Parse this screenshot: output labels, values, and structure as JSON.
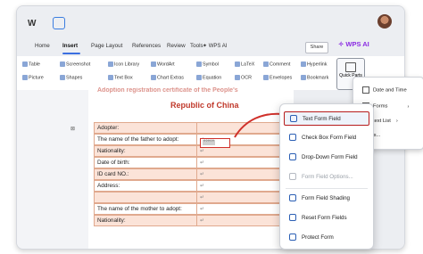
{
  "titlebar": {
    "logo": "W",
    "right_label": "WPS AI"
  },
  "menubar": {
    "items": [
      "Home",
      "Insert",
      "Page Layout",
      "References",
      "Review",
      "Tools"
    ],
    "active": "Insert",
    "ai_label": "WPS AI",
    "share_label": "Share"
  },
  "ribbon": {
    "table": "Table",
    "picture": "Picture",
    "screenshot": "Screenshot",
    "shapes": "Shapes",
    "icon_library": "Icon Library",
    "text_box": "Text Box",
    "wordart": "WordArt",
    "chart_extras": "Chart Extras",
    "symbol": "Symbol",
    "equation": "Equation",
    "latex": "LaTeX",
    "ocr": "OCR",
    "comment": "Comment",
    "envelopes": "Envelopes",
    "hyperlink": "Hyperlink",
    "bookmark": "Bookmark",
    "quick_parts": "Quick Parts"
  },
  "document": {
    "heading_faded": "Adoption registration certificate of the People's",
    "heading": "Republic of China",
    "rows": [
      {
        "label": "Adopter:",
        "mark": "↵"
      },
      {
        "label": "The name of the father to adopt:",
        "mark": "↵"
      },
      {
        "label": "Nationality:",
        "mark": "↵"
      },
      {
        "label": "Date of birth:",
        "mark": "↵"
      },
      {
        "label": "ID card NO.:",
        "mark": "↵"
      },
      {
        "label": "Address:",
        "mark": "↵"
      },
      {
        "label": "",
        "mark": "↵"
      },
      {
        "label": "The name of the mother to adopt:",
        "mark": "↵"
      },
      {
        "label": "Nationality:",
        "mark": "↵"
      }
    ],
    "form_field_text": "°°°°°"
  },
  "quick_parts_menu": {
    "items": [
      "Date and Time",
      "Forms",
      "Autotext List",
      "Fields..."
    ]
  },
  "forms_menu": {
    "items": [
      {
        "label": "Text Form Field",
        "state": "highlight"
      },
      {
        "label": "Check Box Form Field",
        "state": "normal"
      },
      {
        "label": "Drop-Down Form Field",
        "state": "normal"
      },
      {
        "label": "Form Field Options...",
        "state": "disabled"
      },
      {
        "label": "Form Field Shading",
        "state": "normal"
      },
      {
        "label": "Reset Form Fields",
        "state": "normal"
      },
      {
        "label": "Protect Form",
        "state": "normal"
      }
    ]
  },
  "colors": {
    "accent": "#3b6fe0",
    "highlight_border": "#b71c1c",
    "table_shade": "#fbe3d8",
    "heading": "#c0392b"
  }
}
